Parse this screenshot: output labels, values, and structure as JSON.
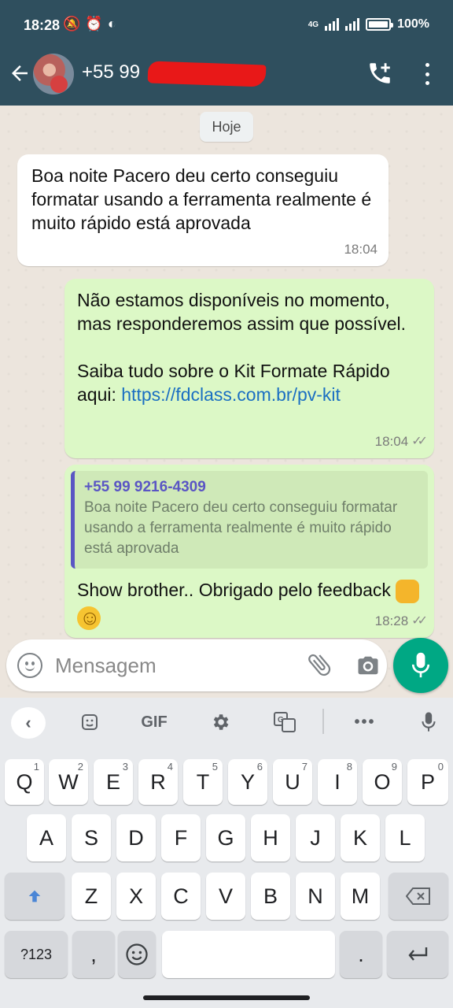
{
  "status_bar": {
    "time": "18:28",
    "network": "4G",
    "battery": "100%"
  },
  "header": {
    "contact_number": "+55 99",
    "icons": {
      "back": "arrow-left-icon",
      "call": "add-call-icon",
      "menu": "more-vert-icon"
    }
  },
  "chat": {
    "date_label": "Hoje",
    "messages": [
      {
        "direction": "incoming",
        "text": "Boa noite Pacero deu certo conseguiu formatar usando a ferramenta realmente é muito rápido está aprovada",
        "time": "18:04"
      },
      {
        "direction": "outgoing",
        "text_part1": "Não estamos disponíveis no momento, mas responderemos assim que possível.",
        "text_part2": "Saiba tudo sobre o Kit Formate Rápido aqui: ",
        "link": "https://fdclass.com.br/pv-kit",
        "time": "18:04",
        "ticks": "✓✓"
      },
      {
        "direction": "outgoing",
        "quote_sender": "+55 99 9216-4309",
        "quote_text": "Boa noite Pacero deu certo conseguiu formatar usando a ferramenta realmente é muito rápido está aprovada",
        "text": "Show brother.. Obrigado pelo feedback",
        "emojis": [
          "oncoming-fist",
          "smiling-face"
        ],
        "time": "18:28",
        "ticks": "✓✓"
      }
    ]
  },
  "composer": {
    "placeholder": "Mensagem",
    "icons": {
      "emoji": "emoji-icon",
      "attach": "paperclip-icon",
      "camera": "camera-icon",
      "mic": "mic-icon"
    },
    "accent": "#00a884"
  },
  "keyboard": {
    "toolbar": {
      "gif": "GIF"
    },
    "row1": [
      {
        "key": "Q",
        "hint": "1"
      },
      {
        "key": "W",
        "hint": "2"
      },
      {
        "key": "E",
        "hint": "3"
      },
      {
        "key": "R",
        "hint": "4"
      },
      {
        "key": "T",
        "hint": "5"
      },
      {
        "key": "Y",
        "hint": "6"
      },
      {
        "key": "U",
        "hint": "7"
      },
      {
        "key": "I",
        "hint": "8"
      },
      {
        "key": "O",
        "hint": "9"
      },
      {
        "key": "P",
        "hint": "0"
      }
    ],
    "row2": [
      "A",
      "S",
      "D",
      "F",
      "G",
      "H",
      "J",
      "K",
      "L"
    ],
    "row3": [
      "Z",
      "X",
      "C",
      "V",
      "B",
      "N",
      "M"
    ],
    "row4": {
      "symbols": "?123",
      "comma": ",",
      "period": "."
    }
  },
  "colors": {
    "header_bg": "#2f4f5e",
    "incoming_bubble": "#ffffff",
    "outgoing_bubble": "#dcf8c6",
    "link": "#1b6fc2",
    "quote_accent": "#5a55c4"
  }
}
